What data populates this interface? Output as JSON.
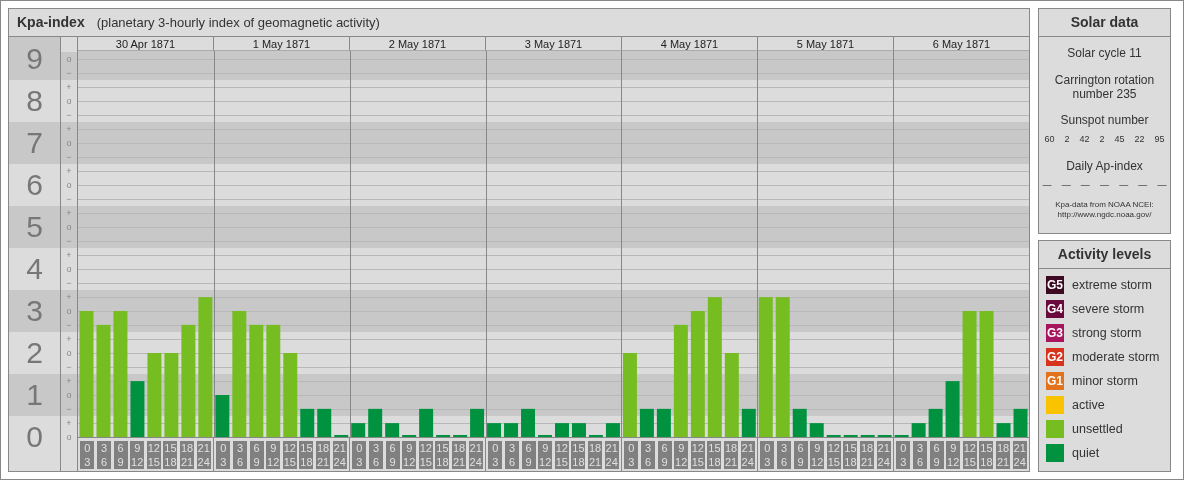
{
  "header": {
    "title": "Kpa-index",
    "subtitle": "(planetary 3-hourly index of geomagnetic activity)"
  },
  "chart": {
    "days": [
      {
        "date": "30 Apr 1871"
      },
      {
        "date": "1 May 1871"
      },
      {
        "date": "2 May 1871"
      },
      {
        "date": "3 May 1871"
      },
      {
        "date": "4 May 1871"
      },
      {
        "date": "5 May 1871"
      },
      {
        "date": "6 May 1871"
      }
    ],
    "minor_ticks": [
      "o",
      "−",
      "+",
      "o",
      "−",
      "+",
      "o",
      "−",
      "+",
      "o",
      "−",
      "+",
      "o",
      "−",
      "+",
      "o",
      "−",
      "+",
      "o",
      "−",
      "+",
      "o",
      "−",
      "+",
      "o",
      "−",
      "+",
      "o"
    ],
    "chart_data": {
      "type": "bar",
      "grid": true,
      "ylim": [
        0,
        9
      ],
      "yticks": [
        {
          "value": 0,
          "label": "0"
        },
        {
          "value": 1,
          "label": "1"
        },
        {
          "value": 2,
          "label": "2"
        },
        {
          "value": 3,
          "label": "3"
        },
        {
          "value": 4,
          "label": "4"
        },
        {
          "value": 5,
          "label": "5"
        },
        {
          "value": 6,
          "label": "6"
        },
        {
          "value": 7,
          "label": "7"
        },
        {
          "value": 8,
          "label": "8"
        },
        {
          "value": 9,
          "label": "9"
        }
      ],
      "categories": [
        "0 3",
        "3 6",
        "6 9",
        "9 12",
        "12 15",
        "15 18",
        "18 21",
        "21 24",
        "0 3",
        "3 6",
        "6 9",
        "9 12",
        "12 15",
        "15 18",
        "18 21",
        "21 24",
        "0 3",
        "3 6",
        "6 9",
        "9 12",
        "12 15",
        "15 18",
        "18 21",
        "21 24",
        "0 3",
        "3 6",
        "6 9",
        "9 12",
        "12 15",
        "15 18",
        "18 21",
        "21 24",
        "0 3",
        "3 6",
        "6 9",
        "9 12",
        "12 15",
        "15 18",
        "18 21",
        "21 24",
        "0 3",
        "3 6",
        "6 9",
        "9 12",
        "12 15",
        "15 18",
        "18 21",
        "21 24",
        "0 3",
        "3 6",
        "6 9",
        "9 12",
        "12 15",
        "15 18",
        "18 21",
        "21 24"
      ],
      "series": [
        {
          "color": "#00923f",
          "values": [
            null,
            null,
            null,
            1.33,
            null,
            null,
            null,
            null,
            1,
            null,
            null,
            null,
            null,
            0.67,
            0.67,
            0,
            0.33,
            0.67,
            0.33,
            0,
            0.67,
            0,
            0,
            0.67,
            0.33,
            0.33,
            0.67,
            0,
            0.33,
            0.33,
            0,
            0.33,
            null,
            0.67,
            0.67,
            null,
            null,
            null,
            null,
            0.67,
            null,
            null,
            0.67,
            0.33,
            0,
            0,
            0,
            0,
            0,
            0.33,
            0.67,
            1.33,
            null,
            null,
            0.33,
            0.67
          ]
        },
        {
          "color": "#76bd22",
          "values": [
            3,
            2.67,
            3,
            null,
            2,
            2,
            2.67,
            3.33,
            null,
            3,
            2.67,
            2.67,
            2,
            null,
            null,
            null,
            null,
            null,
            null,
            null,
            null,
            null,
            null,
            null,
            null,
            null,
            null,
            null,
            null,
            null,
            null,
            null,
            2,
            null,
            null,
            2.67,
            3,
            3.33,
            2,
            null,
            3.33,
            3.33,
            null,
            null,
            null,
            null,
            null,
            null,
            null,
            null,
            null,
            null,
            3,
            3,
            null,
            null
          ]
        }
      ]
    }
  },
  "solar_data": {
    "title": "Solar data",
    "solar_cycle": "Solar cycle 11",
    "carrington": "Carrington rotation number 235",
    "sunspot_title": "Sunspot number",
    "sunspot_numbers": [
      "60",
      "2",
      "42",
      "2",
      "45",
      "22",
      "95"
    ],
    "ap_title": "Daily Ap-index",
    "ap_values": [
      "—",
      "—",
      "—",
      "—",
      "—",
      "—",
      "—"
    ],
    "source": "Kpa-data from NOAA NCEI:",
    "source_url": "http://www.ngdc.noaa.gov/"
  },
  "activity_levels": {
    "title": "Activity levels",
    "items": [
      {
        "badge": "G5",
        "label": "extreme storm",
        "color": "#3d0a22"
      },
      {
        "badge": "G4",
        "label": "severe storm",
        "color": "#6a0a3c"
      },
      {
        "badge": "G3",
        "label": "strong storm",
        "color": "#a8145e"
      },
      {
        "badge": "G2",
        "label": "moderate storm",
        "color": "#d7321c"
      },
      {
        "badge": "G1",
        "label": "minor storm",
        "color": "#e2721c"
      },
      {
        "label": "active",
        "color": "#fac300"
      },
      {
        "label": "unsettled",
        "color": "#76bd22"
      },
      {
        "label": "quiet",
        "color": "#00923f"
      }
    ]
  }
}
